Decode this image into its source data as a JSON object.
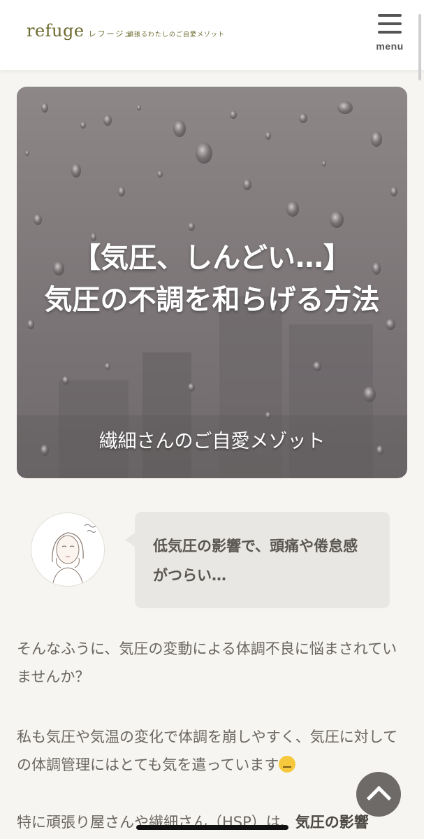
{
  "header": {
    "logo_word": "refuge",
    "logo_kana": "レフージュ",
    "tagline": "頑張るわたしのご自愛メゾット",
    "menu_label": "menu"
  },
  "hero": {
    "title_line1": "【気圧、しんどい…】",
    "title_line2": "気圧の不調を和らげる方法",
    "subtitle": "繊細さんのご自愛メゾット"
  },
  "speech": {
    "text": "低気圧の影響で、頭痛や倦怠感がつらい…"
  },
  "article": {
    "p1": "そんなふうに、気圧の変動による体調不良に悩まされていませんか？",
    "p2": "私も気圧や気温の変化で体調を崩しやすく、気圧に対しての体調管理にはとても気を遣っています",
    "p3_text": "特に頑張り屋さんや繊細さん（HSP）は、",
    "p3_bold": "気圧の影響"
  },
  "icons": {
    "menu": "hamburger-menu-icon",
    "back_to_top": "chevron-up-icon",
    "emoji": "relieved-face-emoji"
  },
  "colors": {
    "logo": "#6b6a2e",
    "page_bg": "#f6f5f1",
    "bubble_bg": "#e8e7e3",
    "to_top_bg": "#6d6a67"
  }
}
